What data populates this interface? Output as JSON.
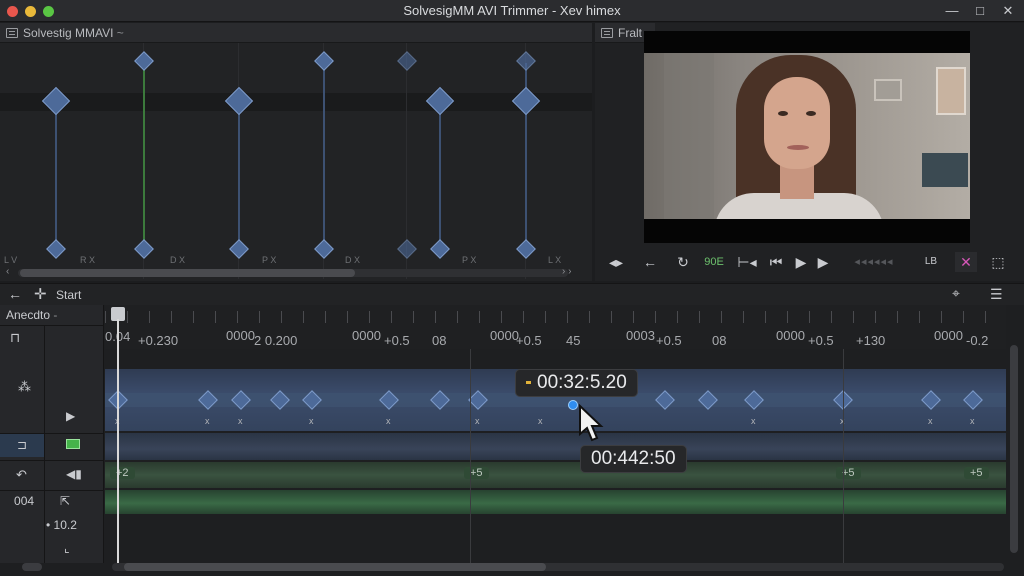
{
  "window": {
    "title": "SolvesigMM AVI Trimmer - Xev himex",
    "controls": [
      "—",
      "□",
      "✕"
    ],
    "traffic_colors": [
      "#e9574d",
      "#e9b93a",
      "#5ac644"
    ]
  },
  "curve_panel": {
    "title": "Solvestig MMAVI",
    "bottom_labels": [
      "L V",
      "R X",
      "D X",
      "P X",
      "D X",
      "P X",
      "L X"
    ]
  },
  "preview_panel": {
    "title": "Fralt"
  },
  "player_toolbar": {
    "buttons": [
      "◂▸",
      "←",
      "↻",
      "90E",
      "⊢◂",
      "⏮",
      "▶",
      "▶",
      "◂◂◂◂◂◂",
      "LB",
      "✕",
      "⬚"
    ]
  },
  "timeline_toolbar": {
    "label": "Start"
  },
  "timeline": {
    "track_name": "Anecdto",
    "ruler": [
      "0.04",
      "+0.230",
      "0000",
      "2 0.200",
      "0000",
      "+0.5",
      "08",
      "0000",
      "+0.5",
      "45",
      "0003",
      "+0.5",
      "08",
      "0000",
      "+0.5",
      "+130",
      "0000",
      "-0.2"
    ],
    "left_values": [
      "04",
      "10.2"
    ],
    "audio_marks": [
      "+2",
      "+5",
      "+5",
      "+5"
    ],
    "timecode_top": "00:32:5.20",
    "timecode_bottom": "00:442:50"
  },
  "colors": {
    "accent": "#4d6a99",
    "video_track": "#3a4a66",
    "audio_track": "#2f4a35",
    "playhead": "#d9d9d9"
  }
}
